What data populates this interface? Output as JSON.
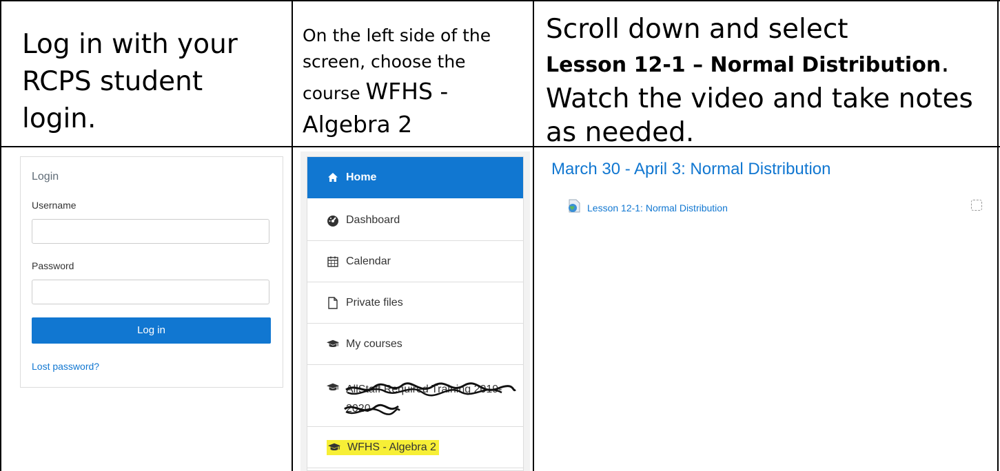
{
  "instructions": {
    "step1": "Log in with your RCPS student login.",
    "step2_small": "On the left side of the screen, choose the course",
    "step2_course": "WFHS - Algebra 2",
    "step3_pre": "Scroll down and select",
    "step3_bold": "Lesson 12-1 – Normal Distribution",
    "step3_post": ". Watch the video and take notes as needed."
  },
  "login": {
    "title": "Login",
    "username_label": "Username",
    "username_value": "",
    "password_label": "Password",
    "password_value": "",
    "button_label": "Log in",
    "lost_password": "Lost password?"
  },
  "nav": {
    "items": [
      {
        "label": "Home",
        "icon": "home-icon"
      },
      {
        "label": "Dashboard",
        "icon": "dashboard-icon"
      },
      {
        "label": "Calendar",
        "icon": "calendar-icon"
      },
      {
        "label": "Private files",
        "icon": "file-icon"
      },
      {
        "label": "My courses",
        "icon": "graduation-cap-icon"
      },
      {
        "label": "AllStaff Required Training 2019-2020",
        "icon": "graduation-cap-icon"
      },
      {
        "label": "WFHS - Algebra 2",
        "icon": "graduation-cap-icon"
      }
    ],
    "highlight_color": "#f7ef36",
    "active_color": "#1177d1"
  },
  "course": {
    "section_title": "March 30 - April 3: Normal Distribution",
    "activity_label": "Lesson 12-1: Normal Distribution",
    "activity_icon": "url-globe-icon"
  }
}
